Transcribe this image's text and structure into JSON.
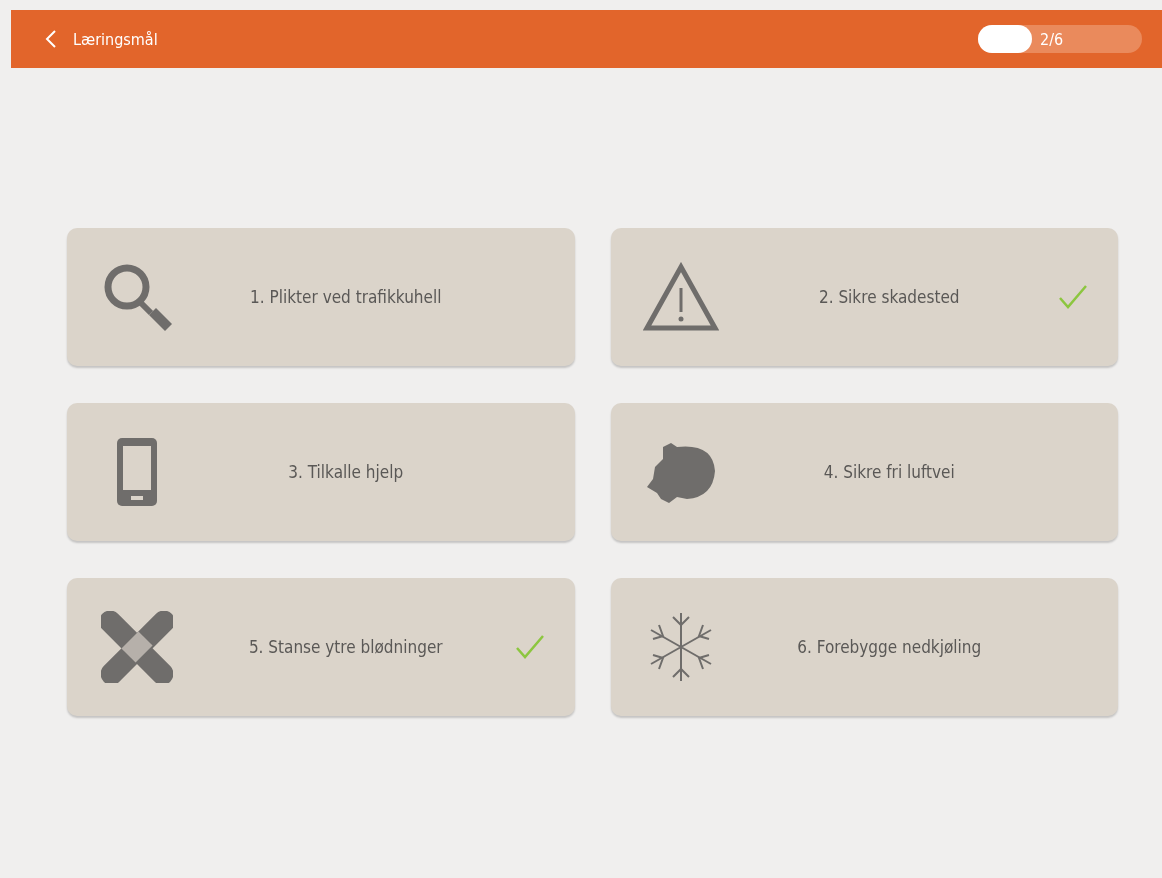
{
  "header": {
    "title": "Læringsmål",
    "progress": {
      "label": "2/6",
      "level": 0.33
    }
  },
  "goals": [
    {
      "label": "1. Plikter ved trafikkuhell",
      "checked": false
    },
    {
      "label": "2. Sikre skadested",
      "checked": true
    },
    {
      "label": "3. Tilkalle hjelp",
      "checked": false
    },
    {
      "label": "4. Sikre fri luftvei",
      "checked": false
    },
    {
      "label": "5. Stanse ytre blødninger",
      "checked": true
    },
    {
      "label": "6. Forebygge nedkjøling",
      "checked": false
    }
  ]
}
